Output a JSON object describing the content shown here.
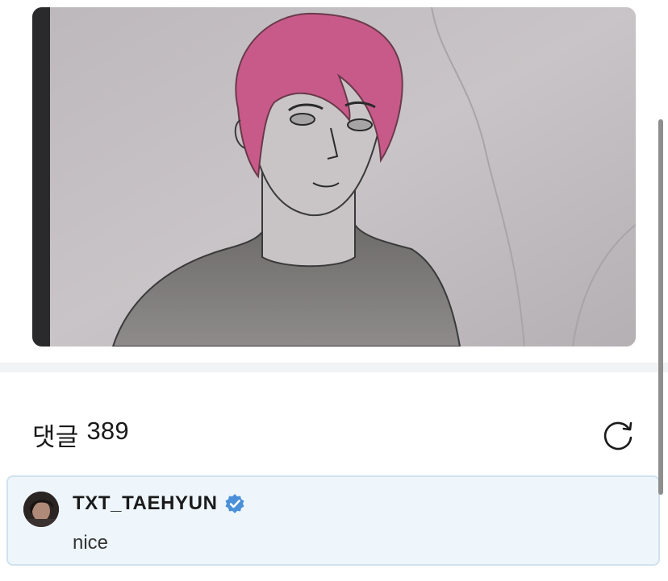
{
  "post": {
    "image_icon": "fan-drawing-image"
  },
  "comments": {
    "label": "댓글",
    "count": "389",
    "refresh_icon": "refresh-icon"
  },
  "comment": {
    "author": "TXT_TAEHYUN",
    "verified_icon": "verified-badge-icon",
    "text": "nice"
  },
  "colors": {
    "accent": "#4a90d9",
    "comment_bg": "#eef6fc",
    "comment_border": "#cfe2ef",
    "divider": "#f1f3f5"
  }
}
